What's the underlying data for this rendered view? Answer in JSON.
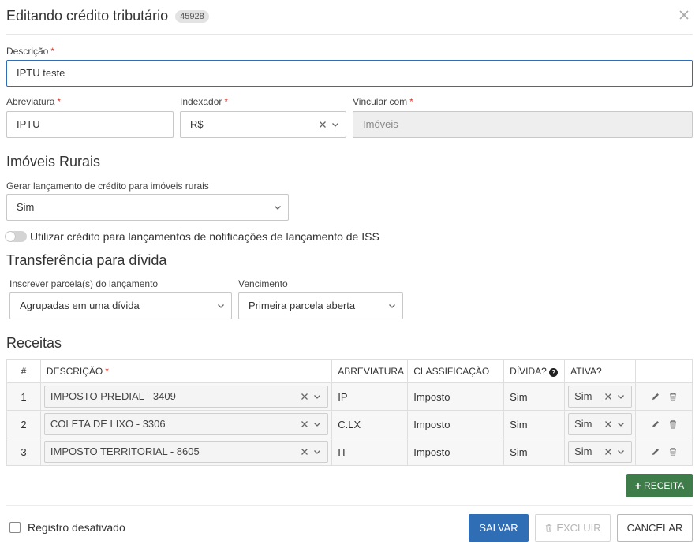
{
  "header": {
    "title": "Editando crédito tributário",
    "badge": "45928"
  },
  "descricao": {
    "label": "Descrição",
    "required": "*",
    "value": "IPTU teste"
  },
  "abreviatura": {
    "label": "Abreviatura",
    "required": "*",
    "value": "IPTU"
  },
  "indexador": {
    "label": "Indexador",
    "required": "*",
    "value": "R$"
  },
  "vincular": {
    "label": "Vincular com",
    "required": "*",
    "value": "Imóveis"
  },
  "imoveis_rurais": {
    "title": "Imóveis Rurais",
    "gerar_label": "Gerar lançamento de crédito para imóveis rurais",
    "gerar_value": "Sim",
    "toggle_label": "Utilizar crédito para lançamentos de notificações de lançamento de ISS"
  },
  "transferencia": {
    "title": "Transferência para dívida",
    "inscrever_label": "Inscrever parcela(s) do lançamento",
    "inscrever_value": "Agrupadas em uma dívida",
    "vencimento_label": "Vencimento",
    "vencimento_value": "Primeira parcela aberta"
  },
  "receitas": {
    "title": "Receitas",
    "columns": {
      "num": "#",
      "descricao": "DESCRIÇÃO",
      "required": "*",
      "abreviatura": "ABREVIATURA",
      "classificacao": "CLASSIFICAÇÃO",
      "divida": "DÍVIDA?",
      "divida_help": "?",
      "ativa": "ATIVA?"
    },
    "rows": [
      {
        "num": "1",
        "descricao": "IMPOSTO PREDIAL - 3409",
        "abreviatura": "IP",
        "classificacao": "Imposto",
        "divida": "Sim",
        "ativa": "Sim"
      },
      {
        "num": "2",
        "descricao": "COLETA DE LIXO - 3306",
        "abreviatura": "C.LX",
        "classificacao": "Imposto",
        "divida": "Sim",
        "ativa": "Sim"
      },
      {
        "num": "3",
        "descricao": "IMPOSTO TERRITORIAL - 8605",
        "abreviatura": "IT",
        "classificacao": "Imposto",
        "divida": "Sim",
        "ativa": "Sim"
      }
    ],
    "add_button": "RECEITA",
    "add_icon_text": "+"
  },
  "footer": {
    "checkbox_label": "Registro desativado",
    "save": "SALVAR",
    "delete": "EXCLUIR",
    "cancel": "CANCELAR"
  },
  "colors": {
    "primary": "#2f6db5",
    "success": "#3e7d4a",
    "required": "#d9352b"
  },
  "icons": {
    "close": "close-icon",
    "clear": "x-icon",
    "chevron": "chevron-down-icon",
    "edit": "pencil-icon",
    "delete": "trash-icon",
    "help": "question-circle-icon",
    "add": "plus-icon"
  }
}
